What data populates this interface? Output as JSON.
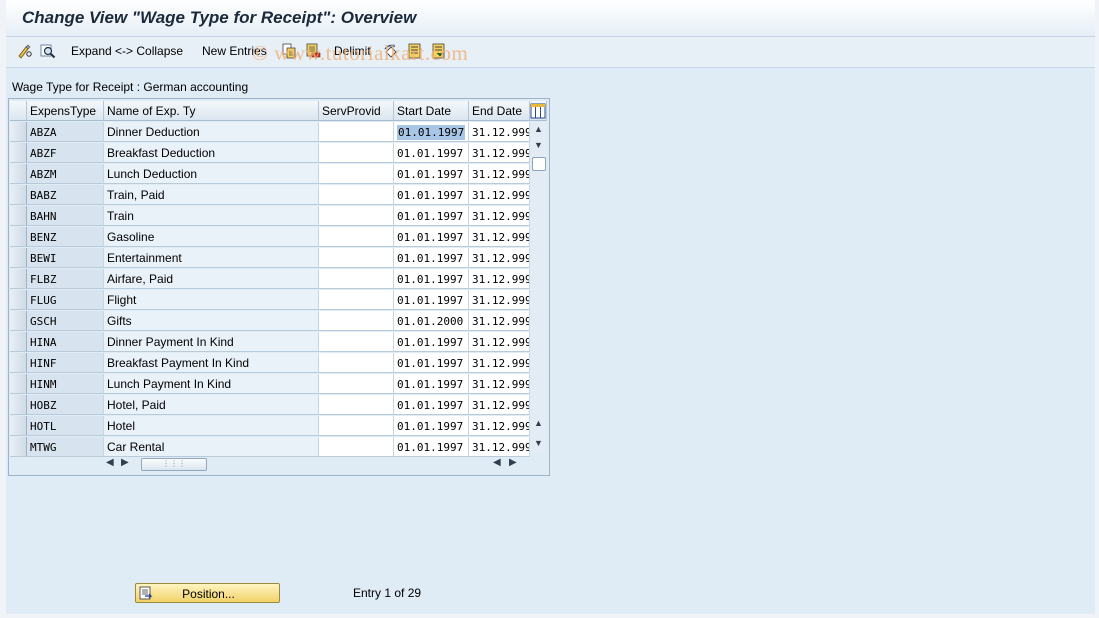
{
  "window": {
    "title": "Change View \"Wage Type for Receipt\": Overview"
  },
  "toolbar": {
    "expand_collapse_label": "Expand <-> Collapse",
    "new_entries_label": "New Entries",
    "delimit_label": "Delimit",
    "watermark": "© www.tutorialkart.com"
  },
  "section": {
    "label": "Wage Type for Receipt : German accounting"
  },
  "table": {
    "headers": {
      "expens_type": "ExpensType",
      "name": "Name of Exp. Ty",
      "serv_provid": "ServProvid",
      "start_date": "Start Date",
      "end_date": "End Date"
    },
    "rows": [
      {
        "type": "ABZA",
        "name": "Dinner Deduction",
        "serv": "",
        "start": "01.01.1997",
        "end": "31.12.999"
      },
      {
        "type": "ABZF",
        "name": "Breakfast Deduction",
        "serv": "",
        "start": "01.01.1997",
        "end": "31.12.999"
      },
      {
        "type": "ABZM",
        "name": "Lunch Deduction",
        "serv": "",
        "start": "01.01.1997",
        "end": "31.12.999"
      },
      {
        "type": "BABZ",
        "name": "Train, Paid",
        "serv": "",
        "start": "01.01.1997",
        "end": "31.12.999"
      },
      {
        "type": "BAHN",
        "name": "Train",
        "serv": "",
        "start": "01.01.1997",
        "end": "31.12.999"
      },
      {
        "type": "BENZ",
        "name": "Gasoline",
        "serv": "",
        "start": "01.01.1997",
        "end": "31.12.999"
      },
      {
        "type": "BEWI",
        "name": "Entertainment",
        "serv": "",
        "start": "01.01.1997",
        "end": "31.12.999"
      },
      {
        "type": "FLBZ",
        "name": "Airfare, Paid",
        "serv": "",
        "start": "01.01.1997",
        "end": "31.12.999"
      },
      {
        "type": "FLUG",
        "name": "Flight",
        "serv": "",
        "start": "01.01.1997",
        "end": "31.12.999"
      },
      {
        "type": "GSCH",
        "name": "Gifts",
        "serv": "",
        "start": "01.01.2000",
        "end": "31.12.999"
      },
      {
        "type": "HINA",
        "name": "Dinner Payment In Kind",
        "serv": "",
        "start": "01.01.1997",
        "end": "31.12.999"
      },
      {
        "type": "HINF",
        "name": "Breakfast Payment In Kind",
        "serv": "",
        "start": "01.01.1997",
        "end": "31.12.999"
      },
      {
        "type": "HINM",
        "name": "Lunch Payment In Kind",
        "serv": "",
        "start": "01.01.1997",
        "end": "31.12.999"
      },
      {
        "type": "HOBZ",
        "name": "Hotel, Paid",
        "serv": "",
        "start": "01.01.1997",
        "end": "31.12.999"
      },
      {
        "type": "HOTL",
        "name": "Hotel",
        "serv": "",
        "start": "01.01.1997",
        "end": "31.12.999"
      },
      {
        "type": "MTWG",
        "name": "Car Rental",
        "serv": "",
        "start": "01.01.1997",
        "end": "31.12.999"
      }
    ]
  },
  "footer": {
    "position_button_label": "Position...",
    "entry_info": "Entry 1 of 29"
  },
  "colors": {
    "background": "#dfebf5",
    "position_button": "#f2d269",
    "focus_highlight": "#a9c6e6"
  }
}
